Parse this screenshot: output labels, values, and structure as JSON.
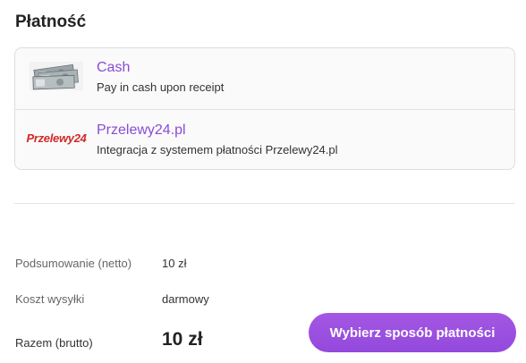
{
  "heading": "Płatność",
  "payment_methods": [
    {
      "name": "Cash",
      "description": "Pay in cash upon receipt",
      "logo": "cash-banknotes-icon"
    },
    {
      "name": "Przelewy24.pl",
      "description": "Integracja z systemem płatności Przelewy24.pl",
      "logo": "przelewy24-logo",
      "logo_text": "Przelewy24"
    }
  ],
  "summary": {
    "net_label": "Podsumowanie (netto)",
    "net_value": "10 zł",
    "shipping_label": "Koszt wysyłki",
    "shipping_value": "darmowy",
    "total_label": "Razem (brutto)",
    "total_value": "10 zł"
  },
  "cta_label": "Wybierz sposób płatności",
  "colors": {
    "accent": "#9b51e0",
    "link": "#8a4bd6",
    "p24_red": "#d12a2a"
  }
}
